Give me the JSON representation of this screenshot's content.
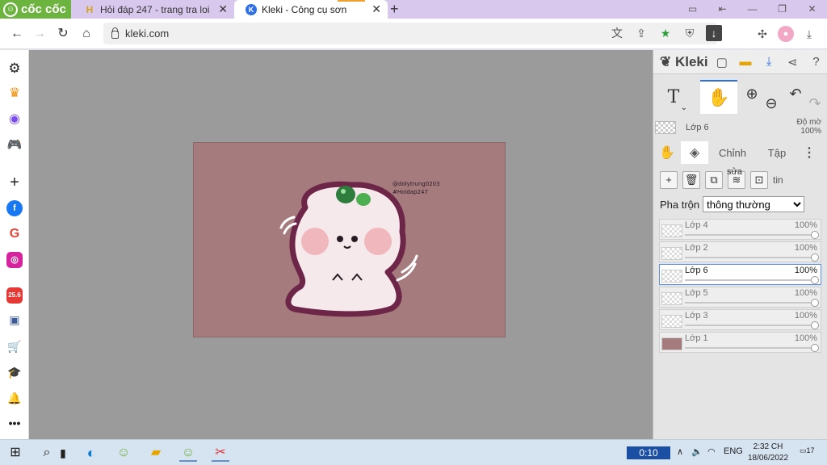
{
  "browser": {
    "brand": "cốc cốc",
    "tabs": [
      {
        "title": "Hỏi đáp 247 - trang tra loi",
        "favicon": "H"
      },
      {
        "title": "Kleki - Công cụ sơn",
        "favicon": "K"
      }
    ],
    "new_tab": "+",
    "url": "kleki.com"
  },
  "canvas_text": {
    "line1": "@dolytrung0203",
    "line2": "#Hoidap247"
  },
  "kleki": {
    "logo": "Kleki",
    "layer_name": "Lớp 6",
    "opacity_label": "Độ mờ",
    "opacity_value": "100%",
    "tabs": [
      "Chỉnh",
      "Tập"
    ],
    "edit_label": "sửa",
    "info_label": "tin",
    "blend_label": "Pha trộn",
    "blend_value": "thông thường",
    "layers": [
      {
        "name": "Lớp 4",
        "opacity": "100%"
      },
      {
        "name": "Lớp 2",
        "opacity": "100%"
      },
      {
        "name": "Lớp 6",
        "opacity": "100%"
      },
      {
        "name": "Lớp 5",
        "opacity": "100%"
      },
      {
        "name": "Lớp 3",
        "opacity": "100%"
      },
      {
        "name": "Lớp 1",
        "opacity": "100%"
      }
    ]
  },
  "taskbar": {
    "timer": "0:10",
    "language": "ENG",
    "time": "2:32 CH",
    "date": "18/06/2022",
    "notifications": "17"
  },
  "colors": {
    "canvas_bg": "#a57b7d",
    "workspace_bg": "#9b9b9b",
    "accent": "#2f6fe6",
    "brand_green": "#6db33f"
  }
}
